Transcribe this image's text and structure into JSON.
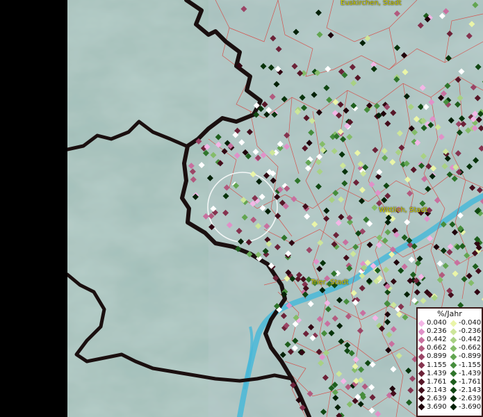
{
  "legend": {
    "title": "%/Jahr",
    "positive": [
      {
        "value": "0.040",
        "color": "#f3b6e6"
      },
      {
        "value": "0.236",
        "color": "#e091c8"
      },
      {
        "value": "0.442",
        "color": "#c8709f"
      },
      {
        "value": "0.662",
        "color": "#b25a7e"
      },
      {
        "value": "0.899",
        "color": "#9b4566"
      },
      {
        "value": "1.155",
        "color": "#85334f"
      },
      {
        "value": "1.439",
        "color": "#6c2238"
      },
      {
        "value": "1.761",
        "color": "#561627"
      },
      {
        "value": "2.143",
        "color": "#430d1b"
      },
      {
        "value": "2.639",
        "color": "#300612"
      },
      {
        "value": "3.690",
        "color": "#1e020a"
      }
    ],
    "negative": [
      {
        "value": "-0.040",
        "color": "#eaf5a8"
      },
      {
        "value": "-0.236",
        "color": "#cde69a"
      },
      {
        "value": "-0.442",
        "color": "#a8d183"
      },
      {
        "value": "-0.662",
        "color": "#84bc69"
      },
      {
        "value": "-0.899",
        "color": "#62a551"
      },
      {
        "value": "-1.155",
        "color": "#468d3c"
      },
      {
        "value": "-1.439",
        "color": "#2f752b"
      },
      {
        "value": "-1.761",
        "color": "#1e5e1d"
      },
      {
        "value": "-2.143",
        "color": "#114813"
      },
      {
        "value": "-2.639",
        "color": "#08330b"
      },
      {
        "value": "-3.690",
        "color": "#032006"
      }
    ]
  },
  "cities": [
    {
      "name": "Euskirchen, Stadt"
    },
    {
      "name": "Wittlich, Stadt"
    },
    {
      "name": "Trier, Stadt"
    }
  ],
  "colors": {
    "terrain": "#a9c6c0",
    "border": "#1a0f0f",
    "district_lines": "#e0302a",
    "river": "#49b8d8",
    "no_data": "#000000"
  }
}
